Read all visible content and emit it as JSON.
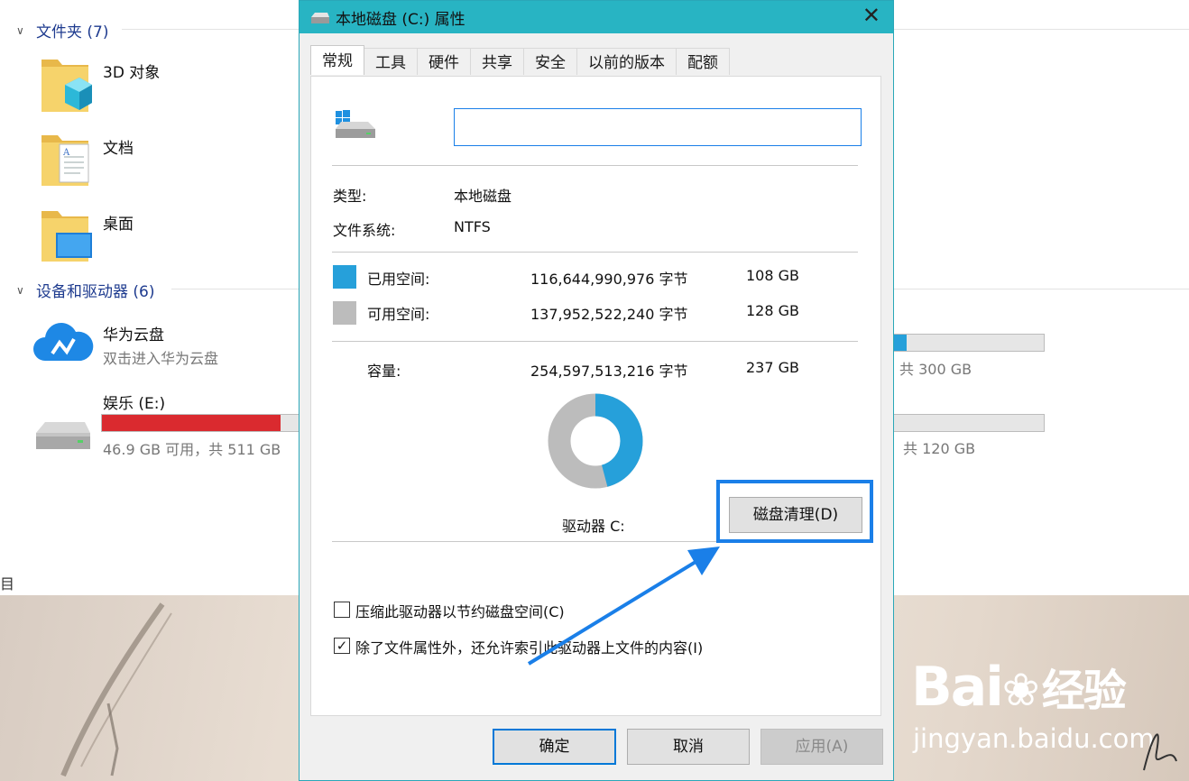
{
  "explorer": {
    "folders_header": "文件夹 (7)",
    "folders": [
      {
        "name": "3D 对象"
      },
      {
        "name": "文档"
      },
      {
        "name": "桌面"
      }
    ],
    "devices_header": "设备和驱动器 (6)",
    "cloud": {
      "name": "华为云盘",
      "sub": "双击进入华为云盘"
    },
    "drive_e": {
      "name": "娱乐 (E:)",
      "sub": "46.9 GB 可用，共 511 GB",
      "usage_fraction": 0.91
    },
    "drive_right_1": {
      "sub": "共 300 GB",
      "usage_fraction": 0.05
    },
    "drive_right_2": {
      "sub": "共 120 GB",
      "usage_fraction": 0.0
    },
    "left_cut_text": "目"
  },
  "dialog": {
    "title": "本地磁盘 (C:) 属性",
    "tabs": [
      "常规",
      "工具",
      "硬件",
      "共享",
      "安全",
      "以前的版本",
      "配额"
    ],
    "active_tab": "常规",
    "drive_label_value": "",
    "type_label": "类型:",
    "type_value": "本地磁盘",
    "fs_label": "文件系统:",
    "fs_value": "NTFS",
    "used": {
      "label": "已用空间:",
      "bytes": "116,644,990,976 字节",
      "size": "108 GB",
      "color": "#26a0da"
    },
    "free": {
      "label": "可用空间:",
      "bytes": "137,952,522,240 字节",
      "size": "128 GB",
      "color": "#bcbcbc"
    },
    "capacity": {
      "label": "容量:",
      "bytes": "254,597,513,216 字节",
      "size": "237 GB"
    },
    "used_fraction": 0.458,
    "drive_caption": "驱动器 C:",
    "cleanup_button": "磁盘清理(D)",
    "compress_checkbox": {
      "label": "压缩此驱动器以节约磁盘空间(C)",
      "checked": false
    },
    "index_checkbox": {
      "label": "除了文件属性外，还允许索引此驱动器上文件的内容(I)",
      "checked": true
    },
    "ok_button": "确定",
    "cancel_button": "取消",
    "apply_button": "应用(A)"
  },
  "watermark": {
    "brand": "Bai",
    "brand_tail": "经验",
    "url": "jingyan.baidu.com"
  },
  "colors": {
    "titlebar": "#28b4c3",
    "accent": "#1a7fe8",
    "drive_e_bar": "#da2a2f"
  }
}
